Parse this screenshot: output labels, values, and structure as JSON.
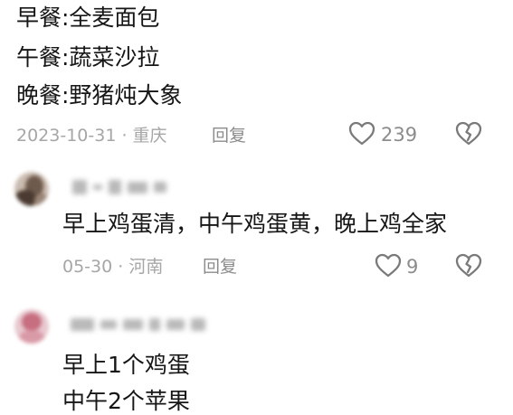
{
  "comment1": {
    "lines": [
      "早餐:全麦面包",
      "午餐:蔬菜沙拉",
      "晚餐:野猪炖大象"
    ],
    "meta": "2023-10-31 · 重庆",
    "reply_label": "回复",
    "likes": "239"
  },
  "comment2": {
    "text": "早上鸡蛋清，中午鸡蛋黄，晚上鸡全家",
    "meta": "05-30 · 河南",
    "reply_label": "回复",
    "likes": "9"
  },
  "comment3": {
    "lines": [
      "早上1个鸡蛋",
      "中午2个苹果"
    ]
  },
  "colors": {
    "text": "#161616",
    "meta": "#a6a6a6",
    "icon": "#7a7a7a"
  },
  "icons": [
    "heart-outline-icon",
    "broken-heart-icon"
  ]
}
